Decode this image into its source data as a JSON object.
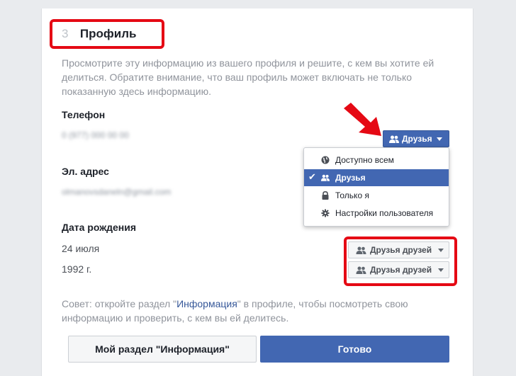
{
  "step": {
    "number": "3",
    "title": "Профиль"
  },
  "description": {
    "line1": "Просмотрите эту информацию из вашего профиля и решите, с кем вы хотите ей",
    "line2": "делиться. Обратите внимание, что ваш профиль может включать не только",
    "line3": "показанную здесь информацию."
  },
  "phone": {
    "label": "Телефон",
    "value": "0 (977) 000 00 00",
    "audience": "Друзья"
  },
  "email": {
    "label": "Эл. адрес",
    "value": "olmanovsdaneln@gmail.com"
  },
  "birthday": {
    "label": "Дата рождения",
    "day_month": "24 июля",
    "year": "1992 г.",
    "day_month_audience": "Друзья друзей",
    "year_audience": "Друзья друзей"
  },
  "audience_menu": {
    "items": [
      {
        "label": "Доступно всем",
        "icon": "globe-icon",
        "selected": false
      },
      {
        "label": "Друзья",
        "icon": "friends-icon",
        "selected": true
      },
      {
        "label": "Только я",
        "icon": "lock-icon",
        "selected": false
      },
      {
        "label": "Настройки пользователя",
        "icon": "gear-icon",
        "selected": false
      }
    ]
  },
  "tip": {
    "prefix": "Совет: откройте раздел \"",
    "link": "Информация",
    "suffix": "\" в профиле, чтобы посмотреть свою",
    "line2": "информацию и проверить, с кем вы ей делитесь."
  },
  "footer": {
    "about_button": "Мой раздел \"Информация\"",
    "done_button": "Готово"
  },
  "colors": {
    "primary": "#4267b2",
    "highlight": "#e50914",
    "arrow": "#e50914"
  }
}
